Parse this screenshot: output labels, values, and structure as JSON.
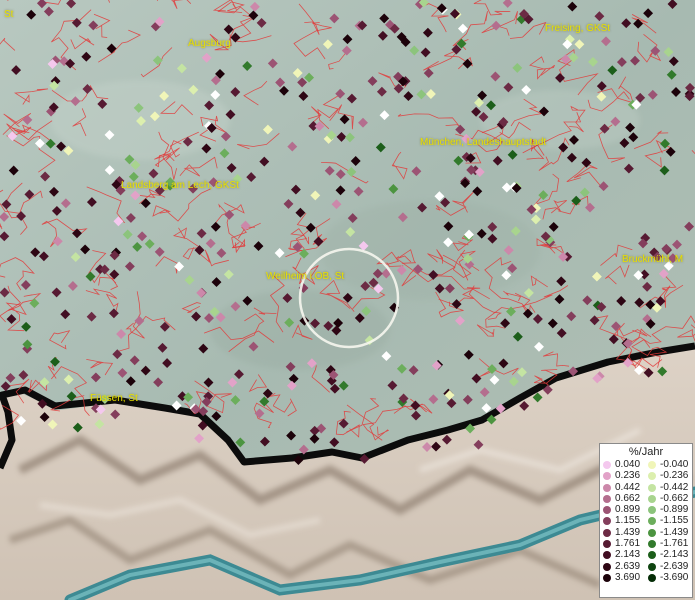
{
  "map": {
    "cities": [
      {
        "id": "st-edge",
        "label": "St"
      },
      {
        "id": "augsburg",
        "label": "Augsburg"
      },
      {
        "id": "freising",
        "label": "Freising, GKSt"
      },
      {
        "id": "muenchen",
        "label": "München, Landeshauptstadt"
      },
      {
        "id": "landsberg",
        "label": "Landsberg am Lech, GKSt"
      },
      {
        "id": "weilheim",
        "label": "Weilheim i.OB, St"
      },
      {
        "id": "bruckmuehl",
        "label": "Bruckmühl, M"
      },
      {
        "id": "fuessen",
        "label": "Füssen, St"
      }
    ],
    "highlight_circle": "Weilheim i.OB, St"
  },
  "legend": {
    "title": "%/Jahr",
    "rows": [
      {
        "pos": "0.040",
        "neg": "-0.040",
        "pos_color": "#f4c8ee",
        "neg_color": "#f0f5b8"
      },
      {
        "pos": "0.236",
        "neg": "-0.236",
        "pos_color": "#e2a2c8",
        "neg_color": "#dcefae"
      },
      {
        "pos": "0.442",
        "neg": "-0.442",
        "pos_color": "#cc88aa",
        "neg_color": "#c4e4a2"
      },
      {
        "pos": "0.662",
        "neg": "-0.662",
        "pos_color": "#b46e8e",
        "neg_color": "#a8d48e"
      },
      {
        "pos": "0.899",
        "neg": "-0.899",
        "pos_color": "#9c5474",
        "neg_color": "#8cc47c"
      },
      {
        "pos": "1.155",
        "neg": "-1.155",
        "pos_color": "#843e5c",
        "neg_color": "#6cae5c"
      },
      {
        "pos": "1.439",
        "neg": "-1.439",
        "pos_color": "#6c2a44",
        "neg_color": "#4c9440"
      },
      {
        "pos": "1.761",
        "neg": "-1.761",
        "pos_color": "#561a32",
        "neg_color": "#327a2c"
      },
      {
        "pos": "2.143",
        "neg": "-2.143",
        "pos_color": "#420e22",
        "neg_color": "#1c5e1a"
      },
      {
        "pos": "2.639",
        "neg": "-2.639",
        "pos_color": "#2e0614",
        "neg_color": "#0e4410"
      },
      {
        "pos": "3.690",
        "neg": "-3.690",
        "pos_color": "#1c020a",
        "neg_color": "#042c06"
      }
    ]
  }
}
